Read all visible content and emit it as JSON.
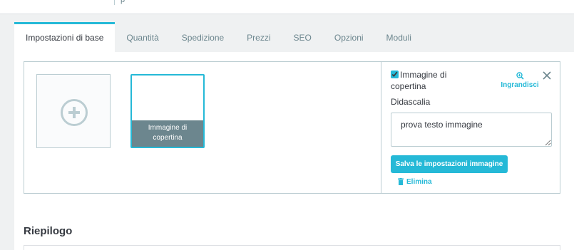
{
  "topbar": {
    "fragment": "ṕ"
  },
  "tabs": [
    {
      "label": "Impostazioni di base",
      "active": true
    },
    {
      "label": "Quantità",
      "active": false
    },
    {
      "label": "Spedizione",
      "active": false
    },
    {
      "label": "Prezzi",
      "active": false
    },
    {
      "label": "SEO",
      "active": false
    },
    {
      "label": "Opzioni",
      "active": false
    },
    {
      "label": "Moduli",
      "active": false
    }
  ],
  "images": {
    "add_icon": "plus-circle-icon",
    "thumbnail_caption": "Immagine di copertina"
  },
  "image_settings": {
    "cover_checkbox_label": "Immagine di copertina",
    "cover_checked": true,
    "zoom_label": "Ingrandisci",
    "zoom_icon": "zoom-in-icon",
    "close_icon": "close-icon",
    "legend_label": "Didascalia",
    "legend_value": "prova testo immagine",
    "save_label": "Salva le impostazioni immagine",
    "delete_label": "Elimina",
    "delete_icon": "trash-icon"
  },
  "summary": {
    "title": "Riepilogo"
  },
  "colors": {
    "accent": "#25b9d7",
    "border": "#bbcdd2",
    "muted": "#6c868e",
    "text": "#363a41"
  }
}
